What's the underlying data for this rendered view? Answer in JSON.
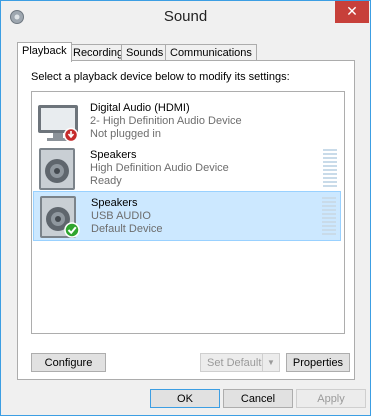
{
  "window": {
    "title": "Sound",
    "close_glyph": "✕"
  },
  "tabs": [
    {
      "label": "Playback"
    },
    {
      "label": "Recording"
    },
    {
      "label": "Sounds"
    },
    {
      "label": "Communications"
    }
  ],
  "instruction": "Select a playback device below to modify its settings:",
  "devices": [
    {
      "name": "Digital Audio (HDMI)",
      "line1": "2- High Definition Audio Device",
      "line2": "Not plugged in",
      "icon": "monitor-icon",
      "badge": "unplugged-badge-icon"
    },
    {
      "name": "Speakers",
      "line1": "High Definition Audio Device",
      "line2": "Ready",
      "icon": "speaker-icon"
    },
    {
      "name": "Speakers",
      "line1": "USB AUDIO",
      "line2": "Default Device",
      "icon": "speaker-icon",
      "badge": "default-check-icon"
    }
  ],
  "buttons": {
    "configure": "Configure",
    "set_default": "Set Default",
    "properties": "Properties",
    "ok": "OK",
    "cancel": "Cancel",
    "apply": "Apply"
  },
  "colors": {
    "accent": "#3c9ee3",
    "close": "#c7403a",
    "selection": "#cce8ff"
  }
}
